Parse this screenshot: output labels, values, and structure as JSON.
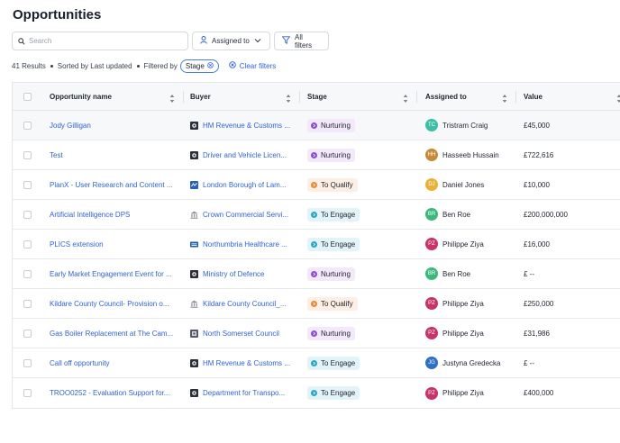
{
  "page": {
    "title": "Opportunities"
  },
  "toolbar": {
    "search_placeholder": "Search",
    "assigned_label": "Assigned to",
    "filters_label": "All filters"
  },
  "status": {
    "results": "41 Results",
    "sorted": "Sorted by Last updated",
    "filtered_by": "Filtered by",
    "filter_chip": "Stage",
    "clear": "Clear filters"
  },
  "columns": {
    "name": "Opportunity name",
    "buyer": "Buyer",
    "stage": "Stage",
    "assigned": "Assigned to",
    "value": "Value"
  },
  "stage_colors": {
    "Nurturing": {
      "bg": "#f3e9fb",
      "icon": "#8a4fd1"
    },
    "To Qualify": {
      "bg": "#fdefe3",
      "icon": "#e88a3a"
    },
    "To Engage": {
      "bg": "#e3f4f8",
      "icon": "#2aa5c4"
    }
  },
  "rows": [
    {
      "name": "Jody Gilligan",
      "buyer": "HM Revenue & Customs ...",
      "buyer_icon": "crest-icon",
      "stage": "Nurturing",
      "initials": "TC",
      "avatar_color": "#3dbfa6",
      "assigned": "Tristram Craig",
      "value": "£45,000"
    },
    {
      "name": "Test",
      "buyer": "Driver and Vehicle Licen...",
      "buyer_icon": "crest-icon",
      "stage": "Nurturing",
      "initials": "HH",
      "avatar_color": "#c88a3a",
      "assigned": "Hasseeb Hussain",
      "value": "£722,616"
    },
    {
      "name": "PlanX - User Research and Content ...",
      "buyer": "London Borough of Lam...",
      "buyer_icon": "council-logo-icon",
      "stage": "To Qualify",
      "initials": "DJ",
      "avatar_color": "#e8b23a",
      "assigned": "Daniel Jones",
      "value": "£10,000"
    },
    {
      "name": "Artificial Intelligence DPS",
      "buyer": "Crown Commercial Servi...",
      "buyer_icon": "building-icon",
      "stage": "To Engage",
      "initials": "BR",
      "avatar_color": "#3cb87a",
      "assigned": "Ben Roe",
      "value": "£200,000,000"
    },
    {
      "name": "PLICS extension",
      "buyer": "Northumbria Healthcare ...",
      "buyer_icon": "nhs-logo-icon",
      "stage": "To Engage",
      "initials": "PZ",
      "avatar_color": "#c8336a",
      "assigned": "Philippe Ziya",
      "value": "£16,000"
    },
    {
      "name": "Early Market Engagement Event for ...",
      "buyer": "Ministry of Defence",
      "buyer_icon": "crest-icon",
      "stage": "Nurturing",
      "initials": "BR",
      "avatar_color": "#3cb87a",
      "assigned": "Ben Roe",
      "value": "£ --"
    },
    {
      "name": "Kildare County Council- Provision o...",
      "buyer": "Kildare County Council_...",
      "buyer_icon": "building-icon",
      "stage": "To Qualify",
      "initials": "PZ",
      "avatar_color": "#c8336a",
      "assigned": "Philippe Ziya",
      "value": "£250,000"
    },
    {
      "name": "Gas Boiler Replacement at The Cam...",
      "buyer": "North Somerset Council",
      "buyer_icon": "council-crest-icon",
      "stage": "Nurturing",
      "initials": "PZ",
      "avatar_color": "#c8336a",
      "assigned": "Philippe Ziya",
      "value": "£31,986"
    },
    {
      "name": "Call off opportunity",
      "buyer": "HM Revenue & Customs ...",
      "buyer_icon": "crest-icon",
      "stage": "To Engage",
      "initials": "JG",
      "avatar_color": "#2f6fc4",
      "assigned": "Justyna Gredecka",
      "value": "£ --"
    },
    {
      "name": "TROO0252 - Evaluation Support for...",
      "buyer": "Department for Transpo...",
      "buyer_icon": "crest-icon",
      "stage": "To Engage",
      "initials": "PZ",
      "avatar_color": "#c8336a",
      "assigned": "Philippe Ziya",
      "value": "£400,000"
    }
  ]
}
